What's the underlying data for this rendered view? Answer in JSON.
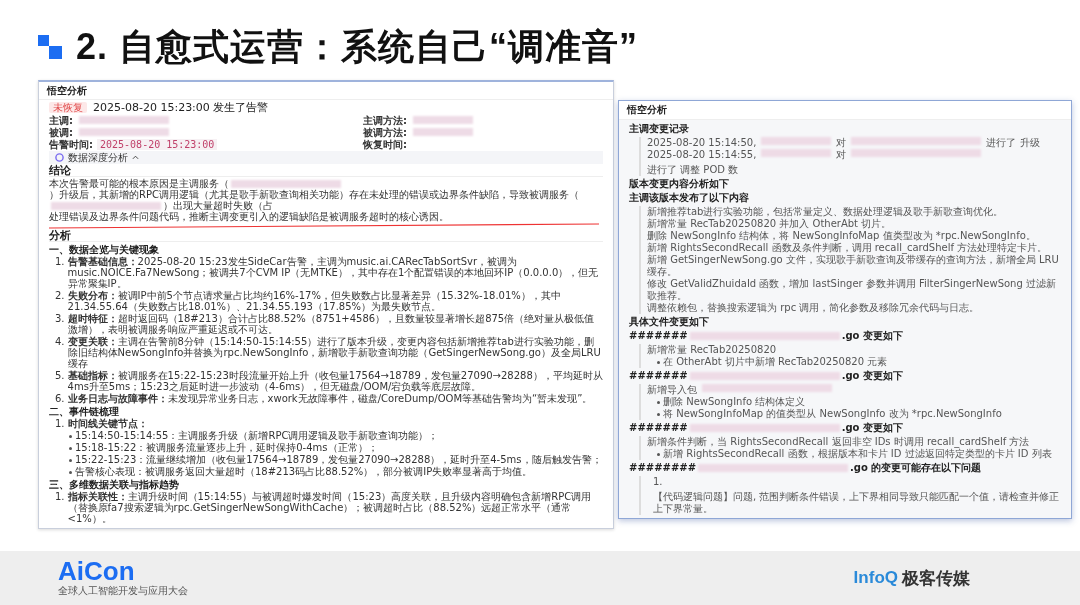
{
  "title": {
    "number": "2.",
    "text": "自愈式运营：系统自己“调准音”"
  },
  "left_panel": {
    "title": "悟空分析",
    "status_tag": "未恢复",
    "alert": "2025-08-20 15:23:00 发生了告警",
    "fields": [
      {
        "label": "主调:",
        "redacted": true
      },
      {
        "label": "主调方法:",
        "redacted": true
      },
      {
        "label": "被调:",
        "redacted": true
      },
      {
        "label": "被调方法:",
        "redacted": true
      },
      {
        "label": "告警时间:",
        "value": "2025-08-20 15:23:00"
      },
      {
        "label": "恢复时间:",
        "redacted": false
      }
    ],
    "deep_analysis": {
      "label": "数据深度分析",
      "expanded": true
    },
    "conclusion": {
      "heading": "结论",
      "segments": [
        {
          "kind": "text",
          "text": "本次告警最可能的根本原因是主调服务（"
        },
        {
          "kind": "redacted"
        },
        {
          "kind": "text",
          "text": "）升级后，其新增的RPC调用逻辑（尤其是歌手新歌查询相关功能）存在未处理的错误或边界条件缺陷，导致被调服务（"
        },
        {
          "kind": "redacted"
        },
        {
          "kind": "text",
          "text": "）出现大量超时失败（占"
        },
        {
          "kind": "text",
          "text": "处理错误及边界条件问题代码，推断主调变更引入的逻辑缺陷是被调服务超时的核心诱因。"
        }
      ]
    },
    "analysis_heading": "分析",
    "sections": [
      {
        "heading": "一、数据全览与关键现象",
        "items": [
          {
            "marker": "1.",
            "text": "**告警基础信息：**2025-08-20 15:23发生SideCar告警，主调为music.ai.CARecTabSortSvr，被调为music.NOICE.Fa7NewSong；被调共7个CVM IP（无MTKE），其中存在1个配置错误的本地回环IP（0.0.0.0），但无异常聚集IP。"
          },
          {
            "marker": "2.",
            "text": "**失败分布：**被调IP中前5个节点请求量占比均约16%-17%，但失败数占比显著差异（15.32%-18.01%），其中21.34.55.64（失败数占比18.01%）、21.34.55.193（17.85%）为最失败节点。"
          },
          {
            "marker": "3.",
            "text": "**超时特征：**超时返回码（18#213）合计占比88.52%（8751+4586），且数量较显著增长超875倍（绝对量从极低值激增），表明被调服务响应严重延迟或不可达。"
          },
          {
            "marker": "4.",
            "text": "**变更关联：**主调在告警前8分钟（15:14:50-15:14:55）进行了版本升级，变更内容包括新增推荐tab进行实验功能，删除旧结构体NewSongInfo并替换为rpc.NewSongInfo，新增歌手新歌查询功能（GetSingerNewSong.go）及全局LRU缓存"
          },
          {
            "marker": "5.",
            "text": "**基础指标：**被调服务在15:22-15:23时段流量开始上升（收包量17564→18789，发包量27090→28288），平均延时从4ms升至5ms；15:23之后延时进一步波动（4-6ms），但无磁盘/OOM/宕负载等底层故障。"
          },
          {
            "marker": "6.",
            "text": "**业务日志与故障事件：**未发现异常业务日志，xwork无故障事件，磁盘/CoreDump/OOM等基础告警均为“暂未发现”。"
          }
        ]
      },
      {
        "heading": "二、事件链梳理",
        "items": [
          {
            "marker": "1.",
            "text": "**时间线关键节点：**",
            "children": [
              {
                "text": "15:14:50-15:14:55：主调服务升级（新增RPC调用逻辑及歌手新歌查询功能）；"
              },
              {
                "text": "15:18-15:22：被调服务流量逐步上升，延时保持0-4ms（正常）；"
              },
              {
                "text": "15:22-15:23：流量继续增加（收包量17564→18789，发包量27090→28288），延时升至4-5ms，随后触发告警；"
              },
              {
                "text": "告警核心表现：被调服务返回大量超时（18#213码占比88.52%），部分被调IP失败率显著高于均值。"
              }
            ]
          }
        ]
      },
      {
        "heading": "三、多维数据关联与指标趋势",
        "items": [
          {
            "marker": "1.",
            "text": "**指标关联性：**主调升级时间（15:14:55）与被调超时爆发时间（15:23）高度关联，且升级内容明确包含新增RPC调用（替换原fa7搜索逻辑为rpc.GetSingerNewSongWithCache）；被调超时占比（88.52%）远超正常水平（通常<1%）。"
          }
        ]
      }
    ]
  },
  "right_panel": {
    "title": "悟空分析",
    "blocks": [
      {
        "kind": "heading",
        "text": "主调变更记录"
      },
      {
        "kind": "quote",
        "lines": [
          {
            "kind": "line",
            "segments": [
              {
                "kind": "text",
                "text": "2025-08-20 15:14:50,"
              },
              {
                "kind": "redacted_short"
              },
              {
                "kind": "text",
                "text": "对"
              },
              {
                "kind": "redacted_long"
              },
              {
                "kind": "text",
                "text": "进行了 升级"
              }
            ]
          },
          {
            "kind": "line",
            "segments": [
              {
                "kind": "text",
                "text": "2025-08-20 15:14:55,"
              },
              {
                "kind": "redacted_short"
              },
              {
                "kind": "text",
                "text": "对"
              },
              {
                "kind": "redacted_long"
              },
              {
                "kind": "text",
                "text": "进行了 调整 POD 数"
              }
            ]
          }
        ]
      },
      {
        "kind": "heading",
        "text": "版本变更内容分析如下"
      },
      {
        "kind": "heading",
        "text": "主调该版本发布了以下内容"
      },
      {
        "kind": "quote",
        "lines": [
          {
            "kind": "line",
            "segments": [
              {
                "kind": "text",
                "text": "新增推荐tab进行实验功能，包括常量定义、数据处理逻辑及歌手新歌查询优化。"
              }
            ]
          },
          {
            "kind": "line",
            "segments": [
              {
                "kind": "text",
                "text": "新增常量 RecTab20250820 并加入 OtherAbt 切片。"
              }
            ]
          },
          {
            "kind": "line",
            "segments": [
              {
                "kind": "text",
                "text": "删除 NewSongInfo 结构体，将 NewSongInfoMap 值类型改为 *rpc.NewSongInfo。"
              }
            ]
          },
          {
            "kind": "line",
            "segments": [
              {
                "kind": "text",
                "text": "新增 RightsSecondRecall 函数及条件判断，调用 recall_cardShelf 方法处理特定卡片。"
              }
            ]
          },
          {
            "kind": "line",
            "segments": [
              {
                "kind": "text",
                "text": "新增 GetSingerNewSong.go 文件，实现歌手新歌查询及带缓存的查询方法，新增全局 LRU 缓存。"
              }
            ]
          },
          {
            "kind": "line",
            "segments": [
              {
                "kind": "text",
                "text": "修改 GetValidZhuidaId 函数，增加 lastSinger 参数并调用 FilterSingerNewSong 过滤新歌推荐。"
              }
            ]
          },
          {
            "kind": "line",
            "segments": [
              {
                "kind": "text",
                "text": "调整依赖包，替换搜索逻辑为 rpc 调用，简化参数及移除冗余代码与日志。"
              }
            ]
          }
        ]
      },
      {
        "kind": "heading",
        "text": "具体文件变更如下"
      },
      {
        "kind": "file",
        "prefix": "#######",
        "suffix": ".go 变更如下"
      },
      {
        "kind": "quote",
        "lines": [
          {
            "kind": "line",
            "segments": [
              {
                "kind": "text",
                "text": "新增常量 RecTab20250820"
              }
            ]
          },
          {
            "kind": "bullet",
            "segments": [
              {
                "kind": "text",
                "text": "在 OtherAbt 切片中新增 RecTab20250820 元素"
              }
            ]
          }
        ]
      },
      {
        "kind": "file",
        "prefix": "#######",
        "suffix": ".go 变更如下"
      },
      {
        "kind": "quote",
        "lines": [
          {
            "kind": "line",
            "segments": [
              {
                "kind": "text",
                "text": "新增导入包"
              },
              {
                "kind": "redacted_long"
              }
            ]
          },
          {
            "kind": "bullet",
            "segments": [
              {
                "kind": "text",
                "text": "删除 NewSongInfo 结构体定义"
              }
            ]
          },
          {
            "kind": "bullet",
            "segments": [
              {
                "kind": "text",
                "text": "将 NewSongInfoMap 的值类型从 NewSongInfo 改为 *rpc.NewSongInfo"
              }
            ]
          }
        ]
      },
      {
        "kind": "file",
        "prefix": "#######",
        "suffix": ".go 变更如下"
      },
      {
        "kind": "quote",
        "lines": [
          {
            "kind": "line",
            "segments": [
              {
                "kind": "text",
                "text": "新增条件判断，当 RightsSecondRecall 返回非空 IDs 时调用 recall_cardShelf 方法"
              }
            ]
          },
          {
            "kind": "bullet",
            "segments": [
              {
                "kind": "text",
                "text": "新增 RightsSecondRecall 函数，根据版本和卡片 ID 过滤返回特定类型的卡片 ID 列表"
              }
            ]
          }
        ]
      },
      {
        "kind": "file",
        "prefix": "########",
        "suffix": ".go 的变更可能存在以下问题"
      },
      {
        "kind": "quote",
        "lines": [
          {
            "kind": "numbered",
            "marker": "1.",
            "segments": [
              {
                "kind": "text",
                "text": "【代码逻辑问题】问题, 范围判断条件错误，上下界相同导致只能匹配一个值，请检查并修正上下界常量。"
              }
            ]
          }
        ]
      }
    ]
  },
  "footer": {
    "brand": "AiCon",
    "tagline": "全球人工智能开发与应用大会",
    "partner": "InfoQ",
    "partner_name": "极客传媒"
  }
}
